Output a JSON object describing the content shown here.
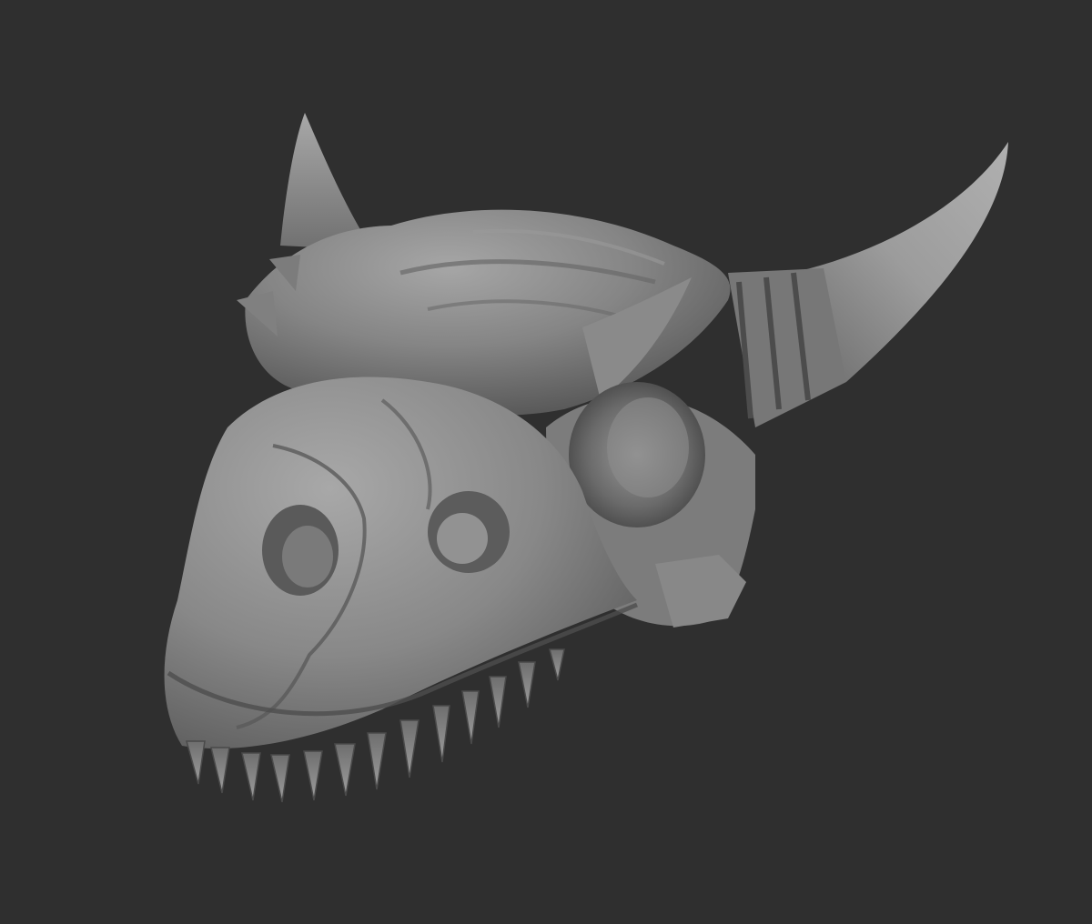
{
  "scene": {
    "background_color": "#2f2f2f",
    "model_color": "#808080",
    "highlight_color": "#b4b4b4",
    "shadow_color": "#3c3c3c",
    "subject_icon": "dragon-skull-sculpt-icon"
  }
}
